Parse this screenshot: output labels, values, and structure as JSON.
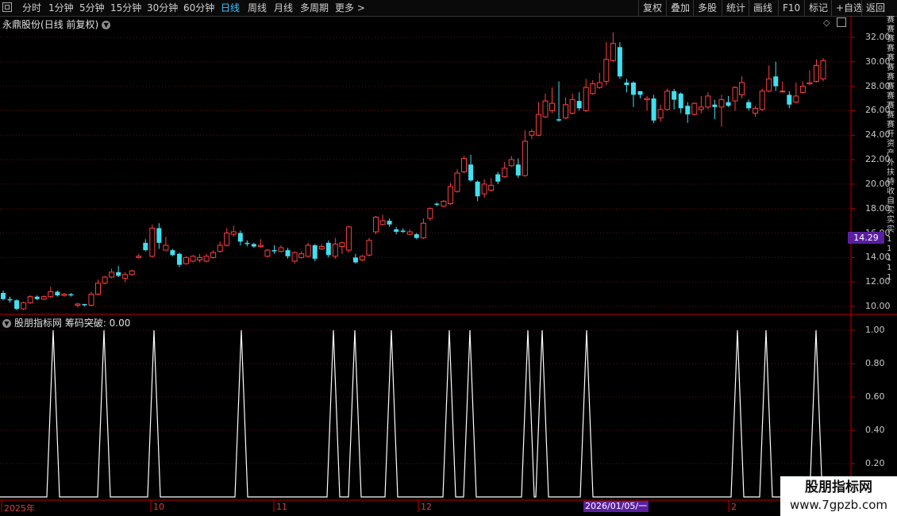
{
  "toolbar": {
    "periods": [
      "分时",
      "1分钟",
      "5分钟",
      "15分钟",
      "30分钟",
      "60分钟",
      "日线",
      "周线",
      "月线",
      "多周期",
      "更多 >"
    ],
    "active_period": "日线",
    "right_buttons": [
      "复权",
      "叠加",
      "多股",
      "统计",
      "画线",
      "F10",
      "标记",
      "+自选",
      "返回"
    ]
  },
  "stock": {
    "name": "永鼎股份",
    "mode": "(日线 前复权)"
  },
  "indicator": {
    "title": "股朋指标网 筹码突破: 0.00"
  },
  "price_axis": {
    "labels": [
      "32.00",
      "30.00",
      "28.00",
      "26.00",
      "24.00",
      "22.00",
      "20.00",
      "18.00",
      "16.00",
      "14.00",
      "12.00",
      "10.00"
    ]
  },
  "indicator_axis": {
    "labels": [
      "1.00",
      "0.80",
      "0.60",
      "0.40",
      "0.20"
    ]
  },
  "current_price": "14.29",
  "time_axis": {
    "labels": [
      {
        "text": "2025年",
        "x": 5
      },
      {
        "text": "10",
        "x": 193
      },
      {
        "text": "11",
        "x": 348
      },
      {
        "text": "12",
        "x": 530
      },
      {
        "text": "2",
        "x": 921
      }
    ],
    "cursor_date": "2026/01/05/一"
  },
  "side_strip_text": "赛赛赛赛赛赛赛赛赛赛赛赛开资产外扶持收自实实实1 1 1 1 1",
  "watermark": {
    "line1": "股朋指标网",
    "line2": "www.7gpzb.com"
  },
  "colors": {
    "up": "#ff4040",
    "down": "#40e0f0",
    "active": "#3ec6ff",
    "highlight": "#5a1fa0",
    "axis": "#c00000"
  },
  "chart_data": {
    "type": "candlestick",
    "ylim": [
      9,
      33
    ],
    "candles": [
      [
        11.1,
        10.6,
        11.3,
        10.5
      ],
      [
        10.6,
        10.5,
        10.8,
        10.3
      ],
      [
        10.5,
        9.8,
        10.6,
        9.7
      ],
      [
        9.8,
        10.3,
        10.4,
        9.7
      ],
      [
        10.3,
        10.8,
        10.9,
        10.2
      ],
      [
        10.8,
        10.6,
        10.9,
        10.5
      ],
      [
        10.6,
        10.8,
        10.9,
        10.5
      ],
      [
        10.8,
        11.2,
        11.6,
        10.7
      ],
      [
        11.2,
        10.9,
        11.3,
        10.8
      ],
      [
        10.9,
        11.0,
        11.1,
        10.8
      ],
      [
        11.0,
        10.9,
        11.1,
        10.8
      ],
      [
        10.1,
        10.2,
        10.3,
        9.9
      ],
      [
        10.2,
        10.1,
        10.2,
        10.0
      ],
      [
        10.1,
        11.0,
        11.2,
        10.0
      ],
      [
        11.0,
        11.9,
        12.2,
        10.9
      ],
      [
        11.9,
        12.4,
        12.5,
        11.8
      ],
      [
        12.4,
        12.8,
        13.1,
        12.3
      ],
      [
        12.8,
        12.5,
        13.3,
        12.4
      ],
      [
        12.3,
        12.6,
        12.8,
        12.0
      ],
      [
        12.6,
        12.9,
        13.0,
        12.5
      ],
      [
        14.0,
        14.1,
        14.3,
        13.9
      ],
      [
        15.2,
        14.6,
        15.5,
        14.5
      ],
      [
        14.1,
        16.4,
        16.7,
        14.0
      ],
      [
        16.4,
        15.2,
        16.8,
        14.7
      ],
      [
        14.6,
        15.0,
        15.7,
        14.6
      ],
      [
        14.6,
        14.2,
        14.7,
        14.1
      ],
      [
        14.3,
        13.4,
        14.4,
        13.2
      ],
      [
        13.5,
        14.0,
        14.1,
        13.4
      ],
      [
        13.7,
        14.1,
        14.2,
        13.6
      ],
      [
        13.8,
        14.0,
        14.3,
        13.6
      ],
      [
        13.7,
        14.1,
        14.3,
        13.6
      ],
      [
        14.0,
        14.4,
        14.6,
        13.9
      ],
      [
        14.5,
        15.0,
        15.3,
        14.4
      ],
      [
        15.0,
        16.0,
        16.4,
        14.9
      ],
      [
        15.9,
        16.1,
        16.6,
        15.7
      ],
      [
        16.0,
        15.3,
        16.2,
        15.0
      ],
      [
        15.2,
        15.1,
        15.4,
        14.9
      ],
      [
        15.1,
        14.9,
        15.2,
        14.8
      ],
      [
        14.9,
        15.0,
        15.5,
        14.8
      ],
      [
        14.1,
        14.6,
        14.7,
        14.0
      ],
      [
        14.6,
        14.5,
        15.0,
        14.3
      ],
      [
        14.5,
        14.8,
        15.0,
        14.4
      ],
      [
        14.6,
        14.1,
        14.8,
        13.9
      ],
      [
        13.7,
        14.4,
        14.5,
        13.5
      ],
      [
        14.0,
        14.3,
        14.5,
        13.9
      ],
      [
        14.1,
        15.0,
        15.2,
        14.0
      ],
      [
        15.0,
        13.9,
        15.1,
        13.7
      ],
      [
        14.7,
        14.9,
        15.1,
        14.6
      ],
      [
        15.2,
        14.2,
        15.4,
        14.0
      ],
      [
        14.1,
        15.1,
        15.6,
        13.9
      ],
      [
        14.9,
        15.2,
        15.3,
        14.3
      ],
      [
        14.6,
        16.5,
        16.6,
        14.4
      ],
      [
        14.0,
        13.6,
        14.3,
        13.5
      ],
      [
        13.8,
        14.1,
        14.2,
        13.7
      ],
      [
        14.2,
        15.4,
        15.6,
        14.1
      ],
      [
        16.1,
        17.3,
        17.4,
        15.9
      ],
      [
        16.7,
        17.0,
        17.5,
        16.6
      ],
      [
        17.0,
        16.7,
        17.2,
        16.5
      ],
      [
        16.3,
        16.1,
        16.5,
        15.9
      ],
      [
        16.2,
        16.1,
        16.4,
        16.0
      ],
      [
        15.9,
        16.1,
        16.3,
        15.8
      ],
      [
        15.9,
        15.6,
        16.0,
        15.5
      ],
      [
        15.6,
        16.8,
        17.2,
        15.5
      ],
      [
        17.2,
        18.0,
        18.1,
        17.0
      ],
      [
        18.4,
        18.3,
        18.5,
        18.2
      ],
      [
        18.2,
        18.6,
        18.7,
        18.1
      ],
      [
        18.4,
        19.8,
        20.1,
        18.3
      ],
      [
        19.4,
        20.9,
        21.2,
        19.3
      ],
      [
        21.0,
        22.1,
        22.3,
        20.9
      ],
      [
        21.6,
        20.3,
        22.4,
        20.2
      ],
      [
        20.2,
        19.0,
        20.3,
        18.6
      ],
      [
        19.2,
        20.0,
        20.4,
        18.9
      ],
      [
        19.5,
        19.9,
        20.5,
        19.4
      ],
      [
        20.8,
        20.2,
        21.0,
        20.0
      ],
      [
        20.6,
        21.3,
        21.8,
        20.5
      ],
      [
        21.5,
        22.0,
        22.3,
        21.4
      ],
      [
        21.6,
        20.7,
        22.1,
        20.5
      ],
      [
        20.7,
        23.5,
        24.4,
        20.6
      ],
      [
        24.0,
        24.3,
        24.5,
        23.7
      ],
      [
        24.0,
        25.7,
        26.7,
        23.9
      ],
      [
        25.5,
        26.8,
        27.4,
        25.4
      ],
      [
        26.0,
        26.6,
        27.9,
        25.8
      ],
      [
        25.3,
        25.2,
        28.4,
        25.1
      ],
      [
        25.4,
        26.5,
        27.1,
        25.3
      ],
      [
        25.8,
        26.9,
        27.4,
        25.7
      ],
      [
        26.8,
        26.2,
        27.5,
        26.0
      ],
      [
        26.0,
        27.9,
        28.6,
        25.9
      ],
      [
        27.4,
        28.2,
        28.5,
        27.3
      ],
      [
        27.9,
        28.3,
        29.1,
        27.8
      ],
      [
        28.4,
        30.2,
        31.6,
        28.1
      ],
      [
        30.1,
        31.5,
        32.4,
        30.0
      ],
      [
        31.2,
        28.8,
        31.6,
        28.6
      ],
      [
        28.3,
        28.1,
        28.6,
        27.5
      ],
      [
        28.3,
        27.3,
        28.4,
        26.3
      ],
      [
        27.6,
        27.3,
        27.6,
        27.0
      ],
      [
        26.9,
        27.0,
        27.2,
        26.0
      ],
      [
        27.0,
        25.2,
        27.3,
        25.0
      ],
      [
        25.4,
        26.1,
        26.5,
        25.1
      ],
      [
        26.1,
        27.6,
        27.8,
        26.0
      ],
      [
        27.6,
        26.9,
        27.8,
        26.1
      ],
      [
        27.4,
        26.2,
        27.5,
        25.8
      ],
      [
        26.4,
        25.7,
        26.7,
        25.0
      ],
      [
        25.7,
        26.6,
        26.7,
        25.6
      ],
      [
        26.1,
        26.3,
        27.2,
        25.8
      ],
      [
        26.3,
        27.2,
        27.5,
        26.1
      ],
      [
        26.5,
        26.3,
        26.9,
        25.3
      ],
      [
        26.3,
        26.9,
        27.3,
        24.7
      ],
      [
        26.7,
        26.4,
        27.2,
        26.3
      ],
      [
        26.8,
        27.9,
        28.0,
        26.0
      ],
      [
        27.3,
        28.3,
        28.8,
        27.0
      ],
      [
        26.7,
        26.2,
        26.9,
        26.0
      ],
      [
        25.8,
        26.2,
        26.4,
        25.5
      ],
      [
        26.1,
        27.6,
        27.8,
        26.0
      ],
      [
        27.6,
        28.6,
        29.7,
        27.5
      ],
      [
        28.8,
        28.0,
        30.0,
        27.6
      ],
      [
        27.6,
        27.6,
        28.4,
        27.5
      ],
      [
        27.3,
        26.5,
        27.6,
        26.2
      ],
      [
        26.7,
        27.2,
        28.3,
        26.6
      ],
      [
        27.5,
        28.0,
        28.4,
        27.4
      ],
      [
        28.2,
        28.3,
        29.3,
        28.1
      ],
      [
        28.4,
        29.7,
        30.2,
        28.3
      ],
      [
        28.6,
        30.1,
        30.3,
        28.4
      ]
    ],
    "indicator_peaks": [
      67,
      131,
      194,
      304,
      420,
      447,
      493,
      566,
      592,
      665,
      683,
      739,
      929,
      965,
      1028
    ]
  }
}
